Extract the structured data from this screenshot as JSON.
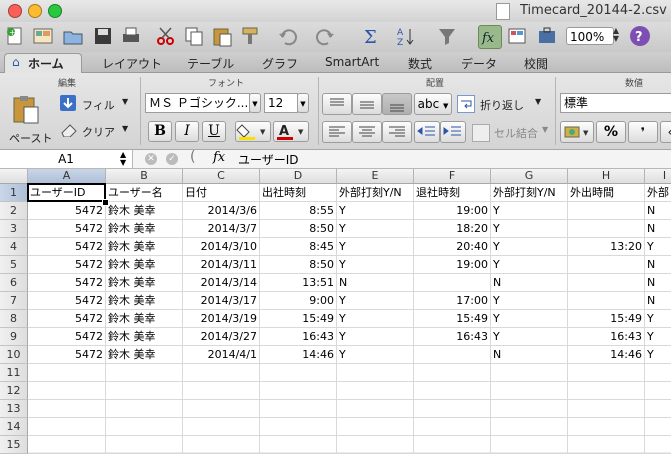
{
  "window": {
    "title": "Timecard_20144-2.csv"
  },
  "toolbar": {
    "zoom": "100%"
  },
  "ribbon_tabs": [
    "ホーム",
    "レイアウト",
    "テーブル",
    "グラフ",
    "SmartArt",
    "数式",
    "データ",
    "校閲"
  ],
  "ribbon": {
    "edit_group": "編集",
    "paste_label": "ペースト",
    "fill_label": "フィル",
    "clear_label": "クリア",
    "font_group": "フォント",
    "font_name": "ＭＳ Ｐゴシック...",
    "font_size": "12",
    "bold": "B",
    "italic": "I",
    "underline": "U",
    "align_group": "配置",
    "abc_label": "abc",
    "wrap_label": "折り返し",
    "merge_label": "セル結合",
    "number_group": "数値",
    "number_format": "標準",
    "percent": "%"
  },
  "formula_bar": {
    "name_box": "A1",
    "fx": "fx",
    "content": "ユーザーID"
  },
  "sheet": {
    "columns": [
      "A",
      "B",
      "C",
      "D",
      "E",
      "F",
      "G",
      "H",
      "I"
    ],
    "row_numbers": [
      "1",
      "2",
      "3",
      "4",
      "5",
      "6",
      "7",
      "8",
      "9",
      "10",
      "11",
      "12",
      "13",
      "14",
      "15"
    ],
    "header": [
      "ユーザーID",
      "ユーザー名",
      "日付",
      "出社時刻",
      "外部打刻Y/N",
      "退社時刻",
      "外部打刻Y/N",
      "外出時間",
      "外部"
    ],
    "rows": [
      [
        "5472",
        "鈴木 美幸",
        "2014/3/6",
        "8:55",
        "Y",
        "19:00",
        "Y",
        "",
        "N"
      ],
      [
        "5472",
        "鈴木 美幸",
        "2014/3/7",
        "8:50",
        "Y",
        "18:20",
        "Y",
        "",
        "N"
      ],
      [
        "5472",
        "鈴木 美幸",
        "2014/3/10",
        "8:45",
        "Y",
        "20:40",
        "Y",
        "13:20",
        "Y"
      ],
      [
        "5472",
        "鈴木 美幸",
        "2014/3/11",
        "8:50",
        "Y",
        "19:00",
        "Y",
        "",
        "N"
      ],
      [
        "5472",
        "鈴木 美幸",
        "2014/3/14",
        "13:51",
        "N",
        "",
        "N",
        "",
        "N"
      ],
      [
        "5472",
        "鈴木 美幸",
        "2014/3/17",
        "9:00",
        "Y",
        "17:00",
        "Y",
        "",
        "N"
      ],
      [
        "5472",
        "鈴木 美幸",
        "2014/3/19",
        "15:49",
        "Y",
        "15:49",
        "Y",
        "15:49",
        "Y"
      ],
      [
        "5472",
        "鈴木 美幸",
        "2014/3/27",
        "16:43",
        "Y",
        "16:43",
        "Y",
        "16:43",
        "Y"
      ],
      [
        "5472",
        "鈴木 美幸",
        "2014/4/1",
        "14:46",
        "Y",
        "",
        "N",
        "14:46",
        "Y"
      ]
    ]
  },
  "colors": {
    "accent": "#3b6fb6",
    "font_color": "#d00000",
    "highlight": "#f7e100"
  }
}
